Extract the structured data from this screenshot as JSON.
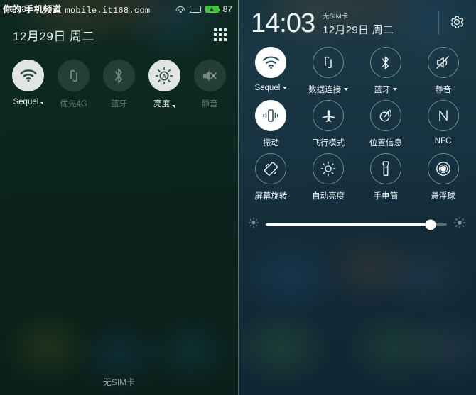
{
  "left": {
    "statusbar": {
      "time": "09:13",
      "battery_percent": "87",
      "icons": [
        "wifi-icon",
        "sim-card-icon",
        "battery-charging-icon"
      ]
    },
    "watermark": {
      "cn": "你的·手机频道",
      "url": "mobile.it168.com"
    },
    "date": "12月29日  周二",
    "grid_button": "app-grid-icon",
    "toggles": [
      {
        "label": "Sequel",
        "icon": "wifi-icon",
        "active": true,
        "has_arrow": true
      },
      {
        "label": "优先4G",
        "icon": "data-connection-icon",
        "active": false,
        "has_arrow": false
      },
      {
        "label": "蓝牙",
        "icon": "bluetooth-icon",
        "active": false,
        "has_arrow": false
      },
      {
        "label": "亮度",
        "icon": "auto-brightness-icon",
        "active": true,
        "has_arrow": true
      },
      {
        "label": "静音",
        "icon": "mute-icon",
        "active": false,
        "has_arrow": false
      }
    ],
    "bottom_text": "无SIM卡"
  },
  "right": {
    "time": "14:03",
    "sim_status": "无SIM卡",
    "date": "12月29日 周二",
    "settings_label": "gear-icon",
    "rows": [
      [
        {
          "label": "Sequel",
          "icon": "wifi-icon",
          "active": true,
          "caret": true
        },
        {
          "label": "数据连接",
          "icon": "data-connection-icon",
          "active": false,
          "caret": true
        },
        {
          "label": "蓝牙",
          "icon": "bluetooth-icon",
          "active": false,
          "caret": true
        },
        {
          "label": "静音",
          "icon": "mute-icon",
          "active": false,
          "caret": false
        }
      ],
      [
        {
          "label": "振动",
          "icon": "vibrate-icon",
          "active": true,
          "caret": false
        },
        {
          "label": "飞行模式",
          "icon": "airplane-icon",
          "active": false,
          "caret": false
        },
        {
          "label": "位置信息",
          "icon": "location-icon",
          "active": false,
          "caret": false
        },
        {
          "label": "NFC",
          "icon": "nfc-icon",
          "active": false,
          "caret": false
        }
      ],
      [
        {
          "label": "屏幕旋转",
          "icon": "screen-rotate-icon",
          "active": false,
          "caret": false
        },
        {
          "label": "自动亮度",
          "icon": "auto-brightness-icon",
          "active": false,
          "caret": false
        },
        {
          "label": "手电筒",
          "icon": "flashlight-icon",
          "active": false,
          "caret": false
        },
        {
          "label": "悬浮球",
          "icon": "floating-ball-icon",
          "active": false,
          "caret": false
        }
      ]
    ],
    "brightness": {
      "value_percent": 91,
      "min_icon": "brightness-low-icon",
      "max_icon": "brightness-high-icon"
    }
  },
  "colors": {
    "left_bg": "#0b241d",
    "right_bg": "#173240",
    "active_toggle": "#ffffff",
    "battery_green": "#3fc23f"
  }
}
